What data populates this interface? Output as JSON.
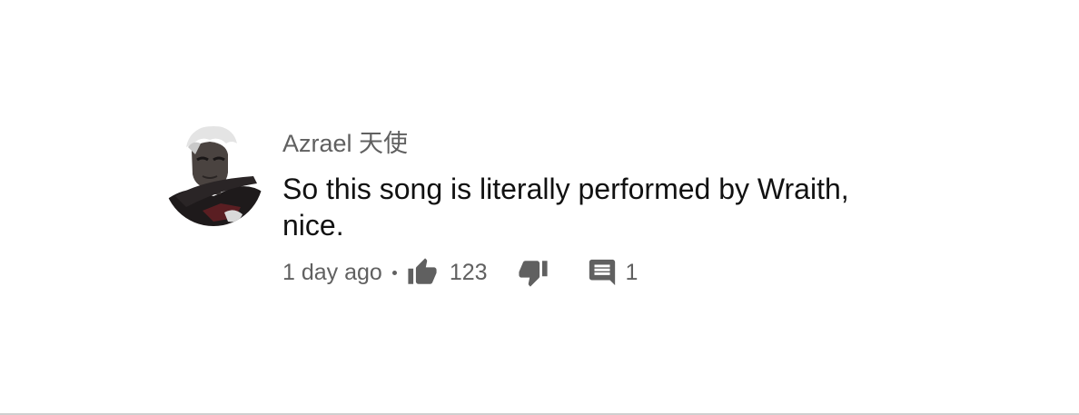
{
  "comment": {
    "author": "Azrael 天使",
    "text": "So this song is literally performed by Wraith, nice.",
    "time": "1 day ago",
    "likes": "123",
    "replies": "1",
    "avatar_icon": "avatar-portrait",
    "like_icon": "thumb-up-icon",
    "dislike_icon": "thumb-down-icon",
    "reply_icon": "comment-icon"
  },
  "colors": {
    "text_primary": "#111111",
    "text_secondary": "#606060",
    "background": "#ffffff"
  }
}
